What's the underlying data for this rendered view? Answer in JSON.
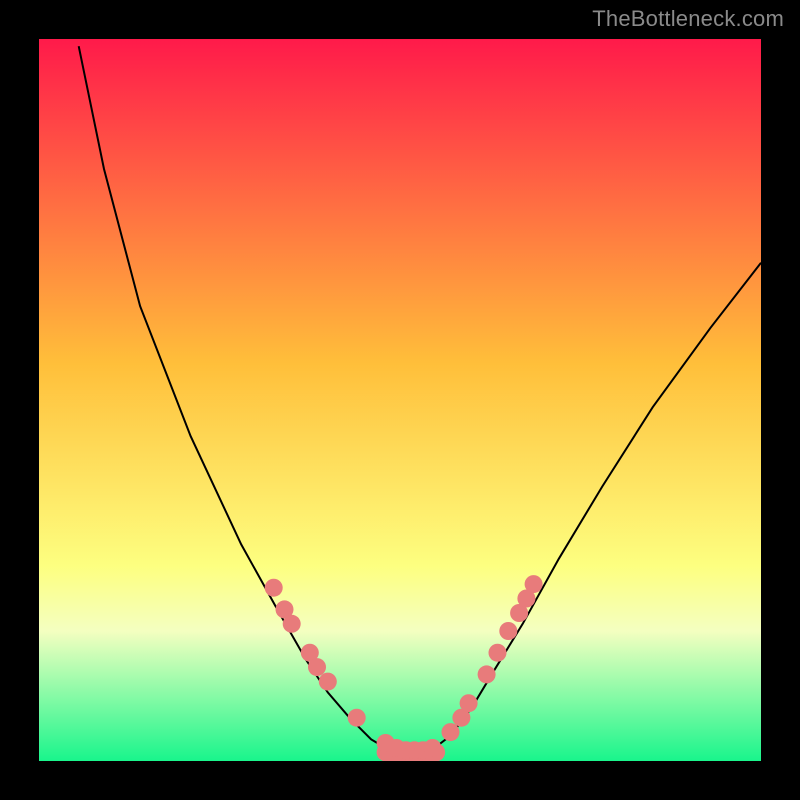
{
  "watermark": "TheBottleneck.com",
  "chart_data": {
    "type": "line",
    "title": "",
    "xlabel": "",
    "ylabel": "",
    "xlim": [
      0,
      100
    ],
    "ylim": [
      0,
      100
    ],
    "curve_left": [
      {
        "x": 5.5,
        "y": 99
      },
      {
        "x": 9,
        "y": 82
      },
      {
        "x": 14,
        "y": 63
      },
      {
        "x": 21,
        "y": 45
      },
      {
        "x": 28,
        "y": 30
      },
      {
        "x": 33,
        "y": 21
      },
      {
        "x": 37,
        "y": 14
      },
      {
        "x": 40,
        "y": 9.5
      },
      {
        "x": 43,
        "y": 6
      },
      {
        "x": 46,
        "y": 3
      },
      {
        "x": 49,
        "y": 1.2
      }
    ],
    "curve_right": [
      {
        "x": 54,
        "y": 1.2
      },
      {
        "x": 57,
        "y": 3.5
      },
      {
        "x": 60,
        "y": 7.5
      },
      {
        "x": 63,
        "y": 12.5
      },
      {
        "x": 67,
        "y": 19
      },
      {
        "x": 72,
        "y": 28
      },
      {
        "x": 78,
        "y": 38
      },
      {
        "x": 85,
        "y": 49
      },
      {
        "x": 93,
        "y": 60
      },
      {
        "x": 100,
        "y": 69
      }
    ],
    "flat_segment": {
      "x1": 49,
      "x2": 54,
      "y": 1.2
    },
    "points": [
      {
        "x": 32.5,
        "y": 24
      },
      {
        "x": 34,
        "y": 21
      },
      {
        "x": 35,
        "y": 19
      },
      {
        "x": 37.5,
        "y": 15
      },
      {
        "x": 38.5,
        "y": 13
      },
      {
        "x": 40,
        "y": 11
      },
      {
        "x": 44,
        "y": 6
      },
      {
        "x": 48,
        "y": 2.5
      },
      {
        "x": 49.5,
        "y": 1.8
      },
      {
        "x": 50.8,
        "y": 1.5
      },
      {
        "x": 52,
        "y": 1.5
      },
      {
        "x": 53.2,
        "y": 1.5
      },
      {
        "x": 54.5,
        "y": 1.8
      },
      {
        "x": 57,
        "y": 4
      },
      {
        "x": 58.5,
        "y": 6
      },
      {
        "x": 59.5,
        "y": 8
      },
      {
        "x": 62,
        "y": 12
      },
      {
        "x": 63.5,
        "y": 15
      },
      {
        "x": 65,
        "y": 18
      },
      {
        "x": 66.5,
        "y": 20.5
      },
      {
        "x": 67.5,
        "y": 22.5
      },
      {
        "x": 68.5,
        "y": 24.5
      }
    ],
    "gradient": {
      "top_color": "#ff1a4a",
      "mid_hi_color": "#ffbf3a",
      "mid_lo_color": "#fdff80",
      "band_color": "#f4ffc0",
      "bottom_color": "#19f58c"
    }
  }
}
